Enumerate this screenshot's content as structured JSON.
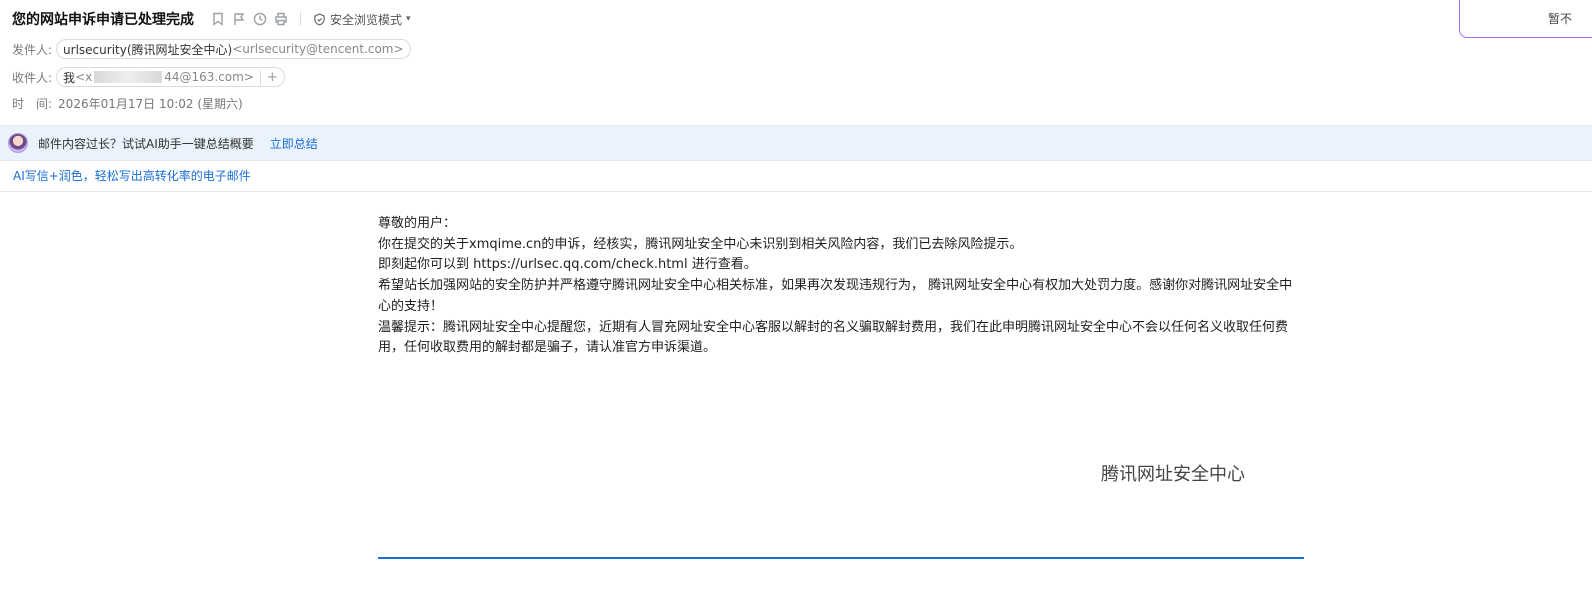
{
  "mail": {
    "subject": "您的网站申诉申请已处理完成",
    "safe_mode_label": "安全浏览模式",
    "from_label": "发件人:",
    "from_name": "urlsecurity(腾讯网址安全中心)",
    "from_addr": "<urlsecurity@tencent.com>",
    "to_label": "收件人:",
    "to_name": "我",
    "to_addr_prefix": "<x",
    "to_addr_suffix": "44@163.com>",
    "add_label": "+",
    "time_label": "时　间:",
    "time_value": "2026年01月17日 10:02 (星期六)",
    "corner_text": "暂不"
  },
  "ai_bar": {
    "text": "邮件内容过长？试试AI助手一键总结概要",
    "link": "立即总结"
  },
  "promo": {
    "text": "AI写信+润色，轻松写出高转化率的电子邮件"
  },
  "content": {
    "lines": [
      "尊敬的用户：",
      "你在提交的关于xmqime.cn的申诉，经核实，腾讯网址安全中心未识别到相关风险内容，我们已去除风险提示。",
      "即刻起你可以到 https://urlsec.qq.com/check.html 进行查看。",
      "希望站长加强网站的安全防护并严格遵守腾讯网址安全中心相关标准，如果再次发现违规行为， 腾讯网址安全中心有权加大处罚力度。感谢你对腾讯网址安全中心的支持！",
      "温馨提示：腾讯网址安全中心提醒您，近期有人冒充网址安全中心客服以解封的名义骗取解封费用，我们在此申明腾讯网址安全中心不会以任何名义收取任何费用，任何收取费用的解封都是骗子，请认准官方申诉渠道。"
    ],
    "signature": "腾讯网址安全中心"
  },
  "icons": [
    "bookmark-icon",
    "flag-icon",
    "clock-icon",
    "print-icon",
    "shield-icon",
    "chevron-down-icon"
  ],
  "colors": {
    "link": "#1a6ed8",
    "ai_bar_bg": "#eaf2fc",
    "corner_border": "#a56be8"
  }
}
